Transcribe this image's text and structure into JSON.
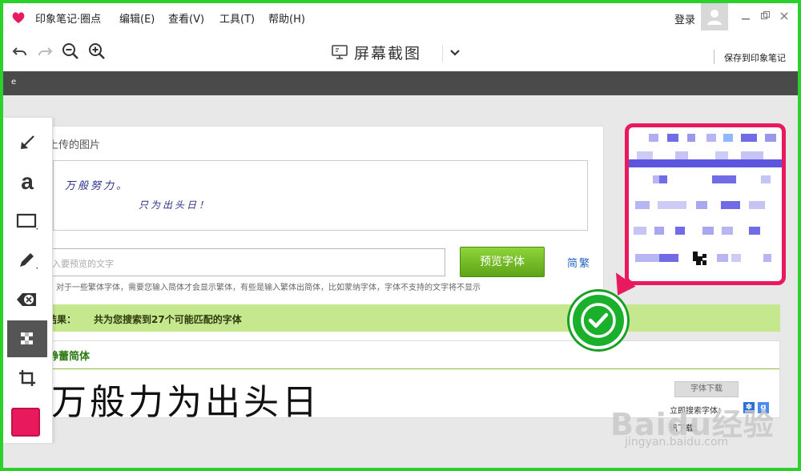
{
  "app": {
    "menu": [
      "印象笔记·圈点",
      "编辑(E)",
      "查看(V)",
      "工具(T)",
      "帮助(H)"
    ],
    "login": "登录",
    "window_controls": [
      "minimize-icon",
      "restore-icon",
      "close-icon"
    ]
  },
  "toolbar": {
    "undo_icon": "undo-icon",
    "redo_icon": "redo-icon",
    "zoom_out_icon": "zoom-out-icon",
    "zoom_in_icon": "zoom-in-icon",
    "title": "屏幕截图",
    "save_label": "保存到印象笔记"
  },
  "darkbar": {
    "text": "e"
  },
  "tools": [
    "arrow-tool-icon",
    "text-tool-icon",
    "rectangle-tool-icon",
    "pen-tool-icon",
    "eraser-tool-icon",
    "mosaic-tool-icon",
    "crop-tool-icon"
  ],
  "tool_text_glyph": "a",
  "current_color": "#e8195d",
  "screenshot": {
    "upload_title": "上传的图片",
    "handwriting_line1": "万般努力。",
    "handwriting_line2": "只为出头日！",
    "input_placeholder": "入要预览的文字",
    "preview_button": "预览字体",
    "trad_link": "简繁",
    "hint": "：对于一些繁体字体，需要您输入简体才会显示繁体，有些是输入繁体出简体，比如蒙纳字体，字体不支持的文字将不显示",
    "result_label": "结果：",
    "result_text": "共为您搜索到27个可能匹配的字体",
    "font_name": "静蕾简体",
    "sample_text": "万般力为出头日",
    "download_button": "字体下载",
    "search_label": "立即搜索字体：",
    "search_label2": "讯下载："
  },
  "watermark": {
    "brand": "Baidu经验",
    "url": "jingyan.baidu.com"
  }
}
